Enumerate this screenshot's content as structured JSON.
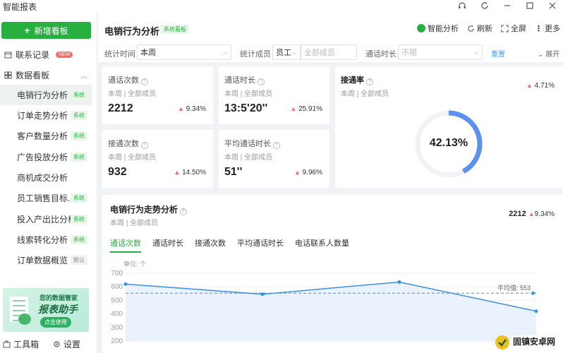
{
  "window": {
    "title": "智能报表",
    "controls": [
      "headset-icon",
      "refresh-icon",
      "minimize-icon",
      "maximize-icon",
      "close-icon"
    ]
  },
  "sidebar": {
    "new_button": "新增看板",
    "contact_log": "联系记录",
    "new_badge": "NEW",
    "data_boards": "数据看板",
    "items": [
      {
        "label": "电销行为分析",
        "tag": "系统"
      },
      {
        "label": "订单走势分析",
        "tag": "系统"
      },
      {
        "label": "客户数量分析",
        "tag": "系统"
      },
      {
        "label": "广告投放分析",
        "tag": "系统"
      },
      {
        "label": "商机成交分析",
        "tag": ""
      },
      {
        "label": "员工销售目标...",
        "tag": "系统"
      },
      {
        "label": "投入产出比分析",
        "tag": "系统"
      },
      {
        "label": "线索转化分析",
        "tag": "系统"
      },
      {
        "label": "订单数据概览",
        "tag": "默认"
      }
    ],
    "promo": {
      "line1": "您的数据管家",
      "line2": "报表助手",
      "cta": "点击使用"
    },
    "toolbox": "工具箱",
    "settings": "设置"
  },
  "header": {
    "title": "电销行为分析",
    "badge": "系统看板",
    "actions": {
      "smart": "智能分析",
      "refresh": "刷新",
      "fullscreen": "全屏",
      "more": "更多"
    }
  },
  "filters": {
    "time_label": "统计时间",
    "time_value": "本周",
    "member_label": "统计成员",
    "member_type": "员工",
    "member_placeholder": "全部成员",
    "duration_label": "通话时长",
    "duration_value": "不限",
    "reset": "重置",
    "expand": "展开"
  },
  "cards": [
    {
      "title": "通话次数",
      "period": "本周",
      "scope": "全部成员",
      "value": "2212",
      "change": "9.34%"
    },
    {
      "title": "通话时长",
      "period": "本周",
      "scope": "全部成员",
      "value": "13:5'20''",
      "change": "25.91%"
    },
    {
      "title": "接通次数",
      "period": "本周",
      "scope": "全部成员",
      "value": "932",
      "change": "14.50%"
    },
    {
      "title": "平均通话时长",
      "period": "本周",
      "scope": "全部成员",
      "value": "51''",
      "change": "9.96%"
    }
  ],
  "rate_card": {
    "title": "接通率",
    "period": "本周",
    "scope": "全部成员",
    "change": "4.71%",
    "value": "42.13%",
    "fraction": 0.4213
  },
  "trend": {
    "title": "电销行为走势分析",
    "period": "本周",
    "scope": "全部成员",
    "total": "2212",
    "change": "9.34%",
    "tabs": [
      "通话次数",
      "通话时长",
      "接通次数",
      "平均通话时长",
      "电话联系人数量"
    ],
    "active_tab": 0,
    "unit": "单位: 个",
    "avg_label": "平均值: 553"
  },
  "chart_data": {
    "type": "area",
    "yticks": [
      700,
      600,
      500,
      400,
      300,
      200
    ],
    "ylim": [
      200,
      700
    ],
    "values": [
      620,
      545,
      635,
      420
    ],
    "average": 553,
    "colors": {
      "line": "#3a8ee6",
      "fill": "#e3effc",
      "avg": "#3a8ee6"
    }
  },
  "colors": {
    "accent": "#27b03f",
    "up": "#f56c6c",
    "ring": "#5b8ff0"
  }
}
